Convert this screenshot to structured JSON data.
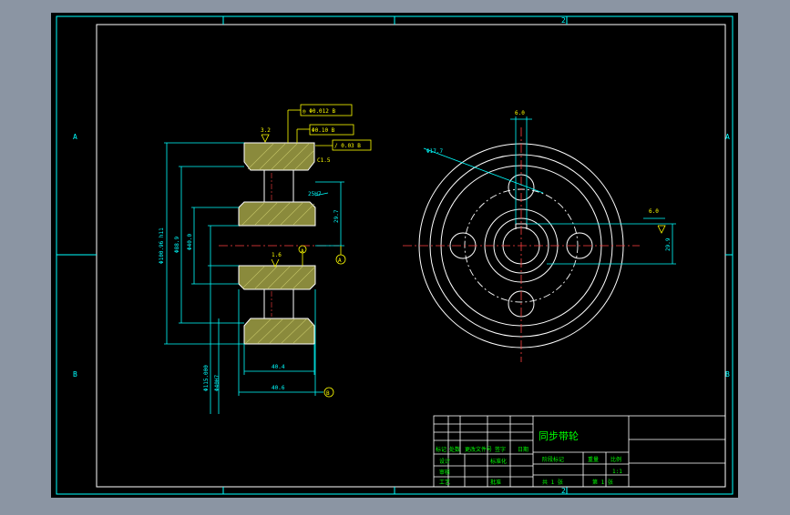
{
  "colors": {
    "background": "#000000",
    "frame": "#00ffff",
    "geometry": "#ffffff",
    "dimension": "#00ffff",
    "annotation": "#ffff00",
    "hatch": "#c8c864",
    "text": "#00ff00",
    "centerline": "#ff0000",
    "outer": "#8b95a3"
  },
  "border": {
    "col_top": "2",
    "col_bottom": "2",
    "row_left_top": "A",
    "row_left_bottom": "B",
    "row_right_top": "A",
    "row_right_bottom": "B"
  },
  "left_view": {
    "surface_finish_top": "3.2",
    "surface_finish_mid": "1.6",
    "tolerance_1": "◎ Φ0.012 B",
    "tolerance_2": "Φ0.10 B",
    "tolerance_3": "/ 0.03 B",
    "chamfer": "C1.5",
    "roughness": "3.2",
    "slot_depth": "29.7",
    "dim_od": "Φ100.96 h11",
    "dim_bore": "Φ40.0",
    "dim_hub": "Φ88.9",
    "dim_side": "Φ40H7",
    "dim_bottom": "Φ115.000",
    "dim_width_inner": "40.4",
    "dim_width_outer": "40.6",
    "datum_a": "A",
    "datum_b": "B",
    "bore_code": "25H7"
  },
  "right_view": {
    "hole_dia": "Φ17.7",
    "top_dim": "6.0",
    "keyway": "6.0",
    "right_dim": "29.9"
  },
  "title_block": {
    "part_name": "同步带轮",
    "h_mark": "标记",
    "h_count": "处数",
    "h_zone": "更改文件号",
    "h_sign": "签字",
    "h_date": "日期",
    "r_design": "设计",
    "r_check": "审核",
    "r_std": "标准化",
    "r_process": "工艺",
    "r_approve": "批准",
    "stage": "阶段标记",
    "weight": "重量",
    "scale": "比例",
    "scale_val": "1:1",
    "sheets": "共 1 张",
    "sheet": "第 1 张"
  }
}
